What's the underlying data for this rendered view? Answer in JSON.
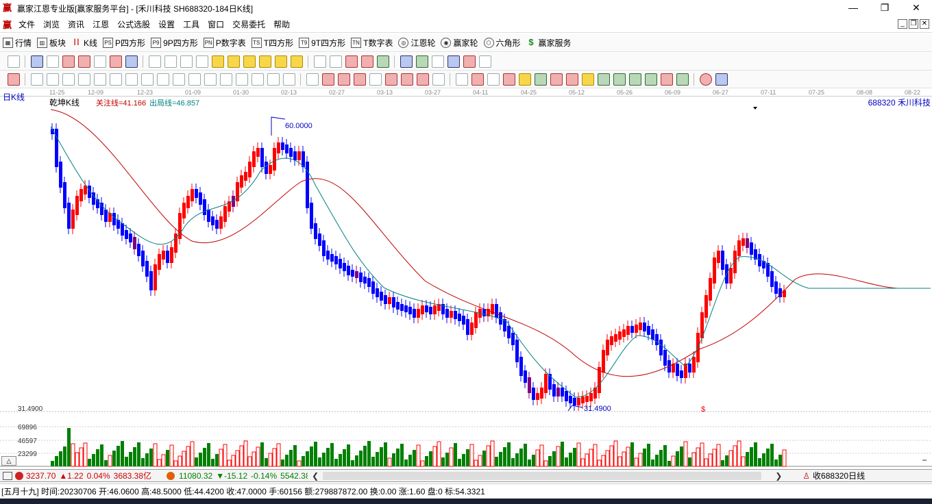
{
  "window": {
    "title": "赢家江恩专业版[赢家服务平台] - [禾川科技  SH688320-184日K线]",
    "app_glyph": "赢",
    "min": "—",
    "max": "❐",
    "close": "✕"
  },
  "menu": [
    "文件",
    "浏览",
    "资讯",
    "江恩",
    "公式选股",
    "设置",
    "工具",
    "窗口",
    "交易委托",
    "帮助"
  ],
  "toolbar1": [
    {
      "label": "行情",
      "icon": "grid-icon"
    },
    {
      "label": "板块",
      "icon": "blocks-icon"
    },
    {
      "label": "K线",
      "icon": "kline-icon"
    },
    {
      "label": "P四方形",
      "icon": "ps-icon",
      "tag": "PS"
    },
    {
      "label": "9P四方形",
      "icon": "p9-icon",
      "tag": "P9"
    },
    {
      "label": "P数字表",
      "icon": "pn-icon",
      "tag": "PN"
    },
    {
      "label": "T四方形",
      "icon": "ts-icon",
      "tag": "TS"
    },
    {
      "label": "9T四方形",
      "icon": "t9-icon",
      "tag": "T9"
    },
    {
      "label": "T数字表",
      "icon": "tn-icon",
      "tag": "TN"
    },
    {
      "label": "江恩轮",
      "icon": "gann-wheel-icon"
    },
    {
      "label": "赢家轮",
      "icon": "winner-wheel-icon"
    },
    {
      "label": "六角形",
      "icon": "hexagon-icon"
    },
    {
      "label": "赢家服务",
      "icon": "dollar-icon",
      "tag": "$"
    }
  ],
  "chart": {
    "period_label": "日K线",
    "indicator_name": "乾坤K线",
    "focus_line": "关注线=41.166",
    "exit_line": "出局线=46.857",
    "stock_code_name": "688320  禾川科技",
    "high_label": "60.0000",
    "low_label": "31.4900",
    "axis_price_label": "31.4900",
    "vol_labels": [
      "69896",
      "46597",
      "23299"
    ],
    "dollar_mark": "$",
    "dates": [
      "11-25",
      "12-09",
      "12-23",
      "01-09",
      "01-30",
      "02-13",
      "02-27",
      "03-13",
      "03-27",
      "04-11",
      "04-25",
      "05-12",
      "05-26",
      "06-09",
      "06-27",
      "07-11",
      "07-25",
      "08-08",
      "08-22"
    ],
    "colors": {
      "up": "#ff0000",
      "down": "#0000ff",
      "special": "#800080",
      "ma_red": "#c00000",
      "ma_teal": "#008080",
      "vol_up": "#ff0000",
      "vol_down": "#008000"
    }
  },
  "status1": {
    "sh_index": "3237.70",
    "sh_change": "▲1.22",
    "sh_pct": "0.04%",
    "sh_amount": "3683.38亿",
    "sz_index": "11080.32",
    "sz_change": "▼-15.12",
    "sz_pct": "-0.14%",
    "sz_amount": "5542.38",
    "right_label": "收688320日线"
  },
  "status2": {
    "text": "[五月十九] 时间:20230706 开:46.0600 高:48.5000 低:44.4200 收:47.0000 手:60156 额:279887872.00 换:0.00 涨:1.60 盘:0 标:54.3321"
  }
}
